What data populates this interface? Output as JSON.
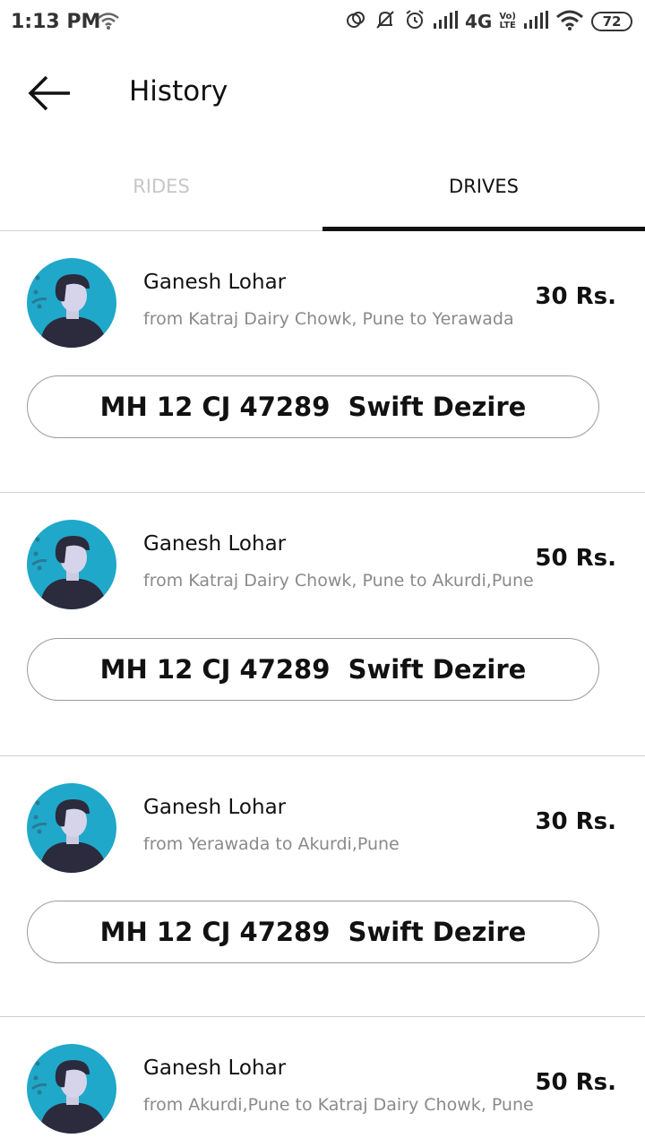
{
  "status_bar": {
    "time": "1:13 PM",
    "network_label": "4G",
    "volte_label_top": "Vo)",
    "volte_label_bottom": "LTE",
    "battery": "72"
  },
  "header": {
    "title": "History",
    "back_icon": "arrow-left-icon"
  },
  "tabs": [
    {
      "label": "RIDES",
      "active": false
    },
    {
      "label": "DRIVES",
      "active": true
    }
  ],
  "colors": {
    "accent": "#111111",
    "avatar_bg": "#1fa8c9",
    "inactive_tab": "#c7c7c7",
    "route_text": "#8a8a8a"
  },
  "drives": [
    {
      "name": "Ganesh Lohar",
      "route": "from Katraj Dairy Chowk, Pune to Yerawada",
      "price": "30 Rs.",
      "vehicle": "MH 12 CJ 47289  Swift Dezire"
    },
    {
      "name": "Ganesh Lohar",
      "route": "from Katraj Dairy Chowk, Pune to Akurdi,Pune",
      "price": "50 Rs.",
      "vehicle": "MH 12 CJ 47289  Swift Dezire"
    },
    {
      "name": "Ganesh Lohar",
      "route": "from Yerawada to Akurdi,Pune",
      "price": "30 Rs.",
      "vehicle": "MH 12 CJ 47289  Swift Dezire"
    },
    {
      "name": "Ganesh Lohar",
      "route": "from Akurdi,Pune to Katraj Dairy Chowk, Pune",
      "price": "50 Rs."
    }
  ]
}
